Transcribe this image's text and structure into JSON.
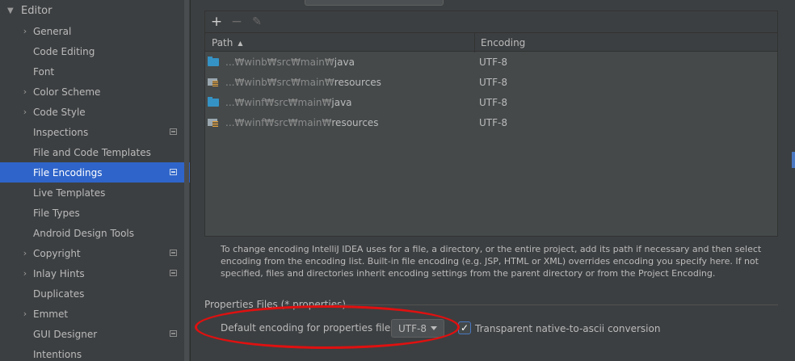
{
  "sidebar": {
    "header": "Editor",
    "items": [
      {
        "label": "General",
        "arrow": true,
        "badge": false,
        "selected": false
      },
      {
        "label": "Code Editing",
        "arrow": false,
        "badge": false,
        "selected": false
      },
      {
        "label": "Font",
        "arrow": false,
        "badge": false,
        "selected": false
      },
      {
        "label": "Color Scheme",
        "arrow": true,
        "badge": false,
        "selected": false
      },
      {
        "label": "Code Style",
        "arrow": true,
        "badge": false,
        "selected": false
      },
      {
        "label": "Inspections",
        "arrow": false,
        "badge": true,
        "selected": false
      },
      {
        "label": "File and Code Templates",
        "arrow": false,
        "badge": false,
        "selected": false
      },
      {
        "label": "File Encodings",
        "arrow": false,
        "badge": true,
        "selected": true
      },
      {
        "label": "Live Templates",
        "arrow": false,
        "badge": false,
        "selected": false
      },
      {
        "label": "File Types",
        "arrow": false,
        "badge": false,
        "selected": false
      },
      {
        "label": "Android Design Tools",
        "arrow": false,
        "badge": false,
        "selected": false
      },
      {
        "label": "Copyright",
        "arrow": true,
        "badge": true,
        "selected": false
      },
      {
        "label": "Inlay Hints",
        "arrow": true,
        "badge": true,
        "selected": false
      },
      {
        "label": "Duplicates",
        "arrow": false,
        "badge": false,
        "selected": false
      },
      {
        "label": "Emmet",
        "arrow": true,
        "badge": false,
        "selected": false
      },
      {
        "label": "GUI Designer",
        "arrow": false,
        "badge": true,
        "selected": false
      },
      {
        "label": "Intentions",
        "arrow": false,
        "badge": false,
        "selected": false
      }
    ]
  },
  "toolbar": {
    "add": "+",
    "remove": "−",
    "edit": "✎"
  },
  "table": {
    "headers": {
      "path": "Path",
      "encoding": "Encoding"
    },
    "rows": [
      {
        "prefix": "...₩winb₩src₩main₩",
        "name": "java",
        "encoding": "UTF-8",
        "icon": "source-folder-icon"
      },
      {
        "prefix": "...₩winb₩src₩main₩",
        "name": "resources",
        "encoding": "UTF-8",
        "icon": "resources-folder-icon"
      },
      {
        "prefix": "...₩winf₩src₩main₩",
        "name": "java",
        "encoding": "UTF-8",
        "icon": "source-folder-icon"
      },
      {
        "prefix": "...₩winf₩src₩main₩",
        "name": "resources",
        "encoding": "UTF-8",
        "icon": "resources-folder-icon"
      }
    ]
  },
  "help_text": "To change encoding IntelliJ IDEA uses for a file, a directory, or the entire project, add its path if necessary and then select encoding from the encoding list. Built-in file encoding (e.g. JSP, HTML or XML) overrides encoding you specify here. If not specified, files and directories inherit encoding settings from the parent directory or from the Project Encoding.",
  "properties": {
    "section_title": "Properties Files (*.properties)",
    "default_label": "Default encoding for properties files:",
    "encoding_value": "UTF-8",
    "transparent_label": "Transparent native-to-ascii conversion",
    "transparent_checked": true
  },
  "colors": {
    "accent": "#2f65ca",
    "highlight": "#e01010",
    "folder": "#3592c4"
  }
}
